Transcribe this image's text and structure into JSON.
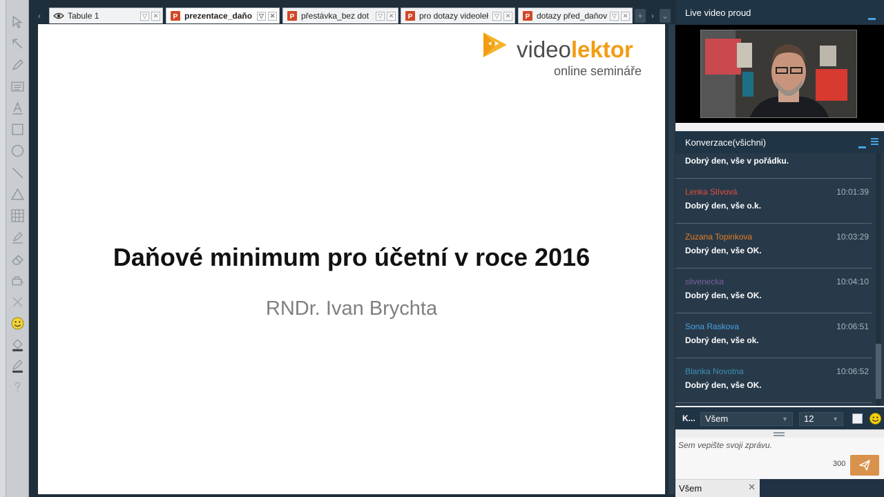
{
  "tabs": [
    {
      "label": "Tabule 1",
      "icon": "eye-icon",
      "active": false
    },
    {
      "label": "prezentace_daňo",
      "icon": "powerpoint-icon",
      "active": true
    },
    {
      "label": "přestávka_bez dot",
      "icon": "powerpoint-icon",
      "active": false
    },
    {
      "label": "pro dotazy videoleł",
      "icon": "powerpoint-icon",
      "active": false
    },
    {
      "label": "dotazy před_daňov",
      "icon": "powerpoint-icon",
      "active": false
    }
  ],
  "tab_buttons": {
    "dropdown": "▽",
    "close": "✕",
    "add": "+",
    "prev": "‹",
    "next": "›",
    "overflow": "⌄"
  },
  "slide": {
    "logo_part1": "video",
    "logo_part2": "lektor",
    "logo_sub": "online semináře",
    "title": "Daňové minimum pro účetní v roce 2016",
    "subtitle": "RNDr. Ivan Brychta"
  },
  "video_panel": {
    "title": "Live video proud"
  },
  "chat_panel": {
    "title": "Konverzace(všichni)"
  },
  "messages": [
    {
      "author": "",
      "time": "",
      "text": "Dobrý den, vše v pořádku.",
      "color": "#e74c3c"
    },
    {
      "author": "Lenka Slívová",
      "time": "10:01:39",
      "text": "Dobrý den, vše o.k.",
      "color": "#e74c3c"
    },
    {
      "author": "Zuzana Topinkova",
      "time": "10:03:29",
      "text": "Dobrý den, vše OK.",
      "color": "#e67e22"
    },
    {
      "author": "slivenecka",
      "time": "10:04:10",
      "text": "Dobrý den, vše OK.",
      "color": "#7d5fa0"
    },
    {
      "author": "Sona Raskova",
      "time": "10:06:51",
      "text": "Dobrý den, vše ok.",
      "color": "#4aa3df"
    },
    {
      "author": "Blanka Novotna",
      "time": "10:06:52",
      "text": "Dobrý den, vše OK.",
      "color": "#3d8fb5"
    }
  ],
  "chat_controls": {
    "label": "K...",
    "recipient": "Všem",
    "font_size": "12"
  },
  "compose": {
    "placeholder": "Sem vepište svoji zprávu.",
    "char_count": "300"
  },
  "bottom_tab": {
    "label": "Všem",
    "close": "✕"
  },
  "colors": {
    "accent": "#4aa3df",
    "send": "#d9924b",
    "brand_orange": "#f39c12",
    "panel_dark": "#1f3445"
  }
}
